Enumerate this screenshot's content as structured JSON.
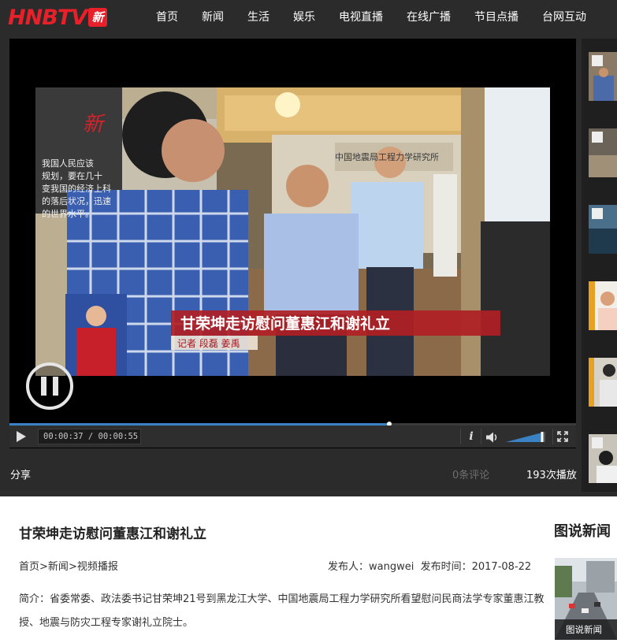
{
  "header": {
    "logo_text": "HNBTV",
    "logo_mark": "新",
    "nav": [
      {
        "label": "首页"
      },
      {
        "label": "新闻"
      },
      {
        "label": "生活"
      },
      {
        "label": "娱乐"
      },
      {
        "label": "电视直播"
      },
      {
        "label": "在线广播"
      },
      {
        "label": "节目点播"
      },
      {
        "label": "台网互动"
      }
    ]
  },
  "player": {
    "video_caption_main": "甘荣坤走访慰问董惠江和谢礼立",
    "video_caption_sub": "记者  段磊  姜禹",
    "video_overlay_lettering": [
      "我国人民应该",
      "规划，要在几十",
      "变我国的经济上科",
      "的落后状况，迅速",
      "的世界水平。"
    ],
    "video_sign_text": "中国地震局工程力学研究所",
    "state": "playing",
    "current_time": "00:00:37",
    "duration": "00:00:55",
    "time_display": "00:00:37 / 00:00:55",
    "progress_fraction": 0.67,
    "volume_fraction": 0.95
  },
  "stats": {
    "share_label": "分享",
    "comments_label": "0条评论",
    "plays_label": "193次播放"
  },
  "article": {
    "title": "甘荣坤走访慰问董惠江和谢礼立",
    "breadcrumb": [
      "首页",
      "新闻",
      "视频播报"
    ],
    "breadcrumb_separator": ">",
    "publisher_label": "发布人：wangwei",
    "publish_time_label": "发布时间：2017-08-22",
    "summary": "简介：省委常委、政法委书记甘荣坤21号到黑龙江大学、中国地震局工程力学研究所看望慰问民商法学专家董惠江教授、地震与防灾工程专家谢礼立院士。"
  },
  "sidebar": {
    "title": "图说新闻",
    "caption": "图说新闻"
  },
  "colors": {
    "brand_red": "#e8202a",
    "progress_blue": "#3b82c4",
    "dark_bg": "#2b2b2b"
  }
}
